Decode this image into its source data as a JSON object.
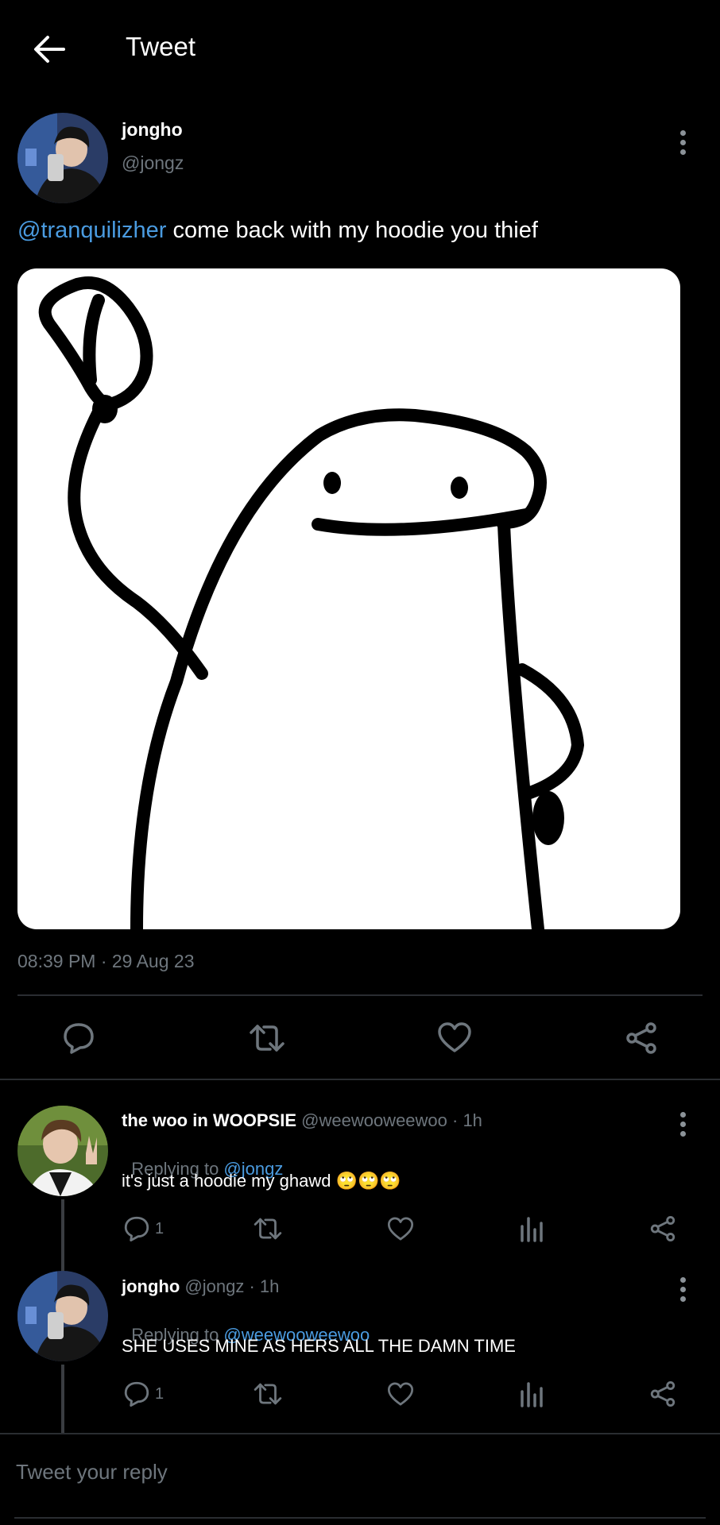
{
  "header": {
    "title": "Tweet"
  },
  "main_tweet": {
    "display_name": "jongho",
    "handle": "@jongz",
    "mention": "@tranquilizher",
    "text": " come back with my hoodie you thief",
    "timestamp": "08:39 PM · 29 Aug 23"
  },
  "replies": [
    {
      "display_name": "the woo in WOOPSIE",
      "meta": "@weewooweewoo · 1h",
      "replying_prefix": "Replying to ",
      "replying_to": "@jongz",
      "text": "it's just a hoodie my ghawd 🙄🙄🙄",
      "reply_count": "1"
    },
    {
      "display_name": "jongho",
      "meta": "@jongz · 1h",
      "replying_prefix": "Replying to ",
      "replying_to": "@weewooweewoo",
      "text": "SHE USES MINE AS HERS ALL THE DAMN TIME",
      "reply_count": "1"
    }
  ],
  "composer": {
    "placeholder": "Tweet your reply"
  },
  "colors": {
    "background": "#000000",
    "link": "#4a9be0",
    "muted": "#6e767d",
    "divider": "#2a2d31"
  },
  "icons": [
    "back-arrow-icon",
    "more-vertical-icon",
    "reply-icon",
    "retweet-icon",
    "like-icon",
    "share-icon",
    "analytics-icon"
  ]
}
